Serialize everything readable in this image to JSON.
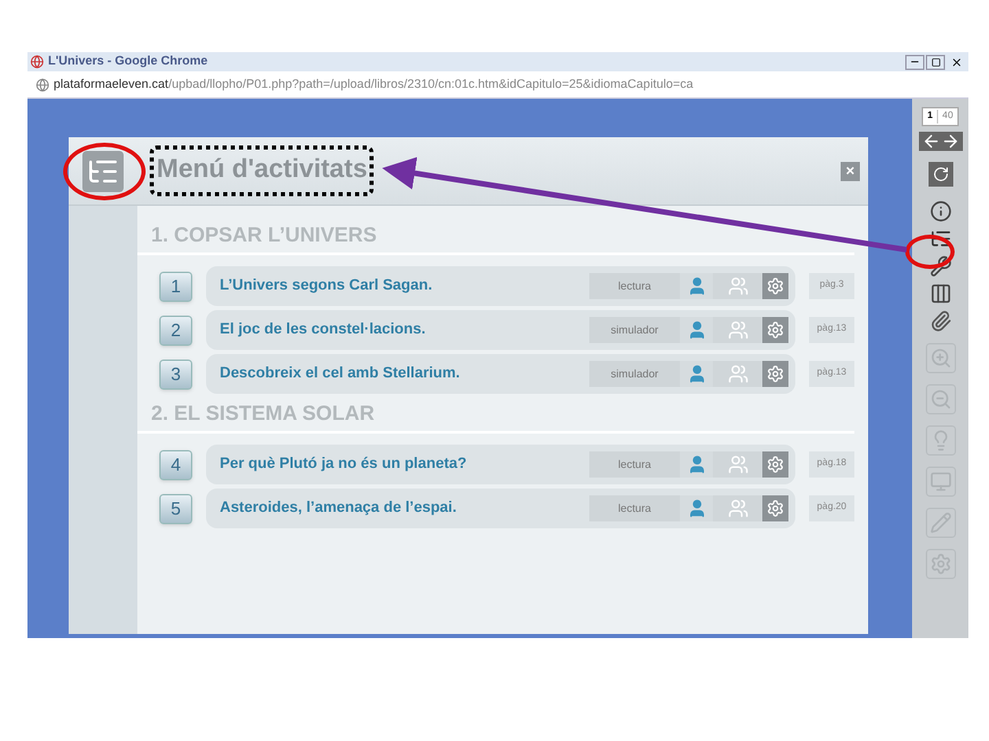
{
  "window": {
    "title": "L'Univers - Google Chrome"
  },
  "address_bar": {
    "host": "plataformaeleven.cat",
    "path": "/upbad/llopho/P01.php?path=/upload/libros/2310/cn:01c.htm&idCapitulo=25&idiomaCapitulo=ca"
  },
  "pager": {
    "current": "1",
    "total": "40"
  },
  "modal": {
    "title": "Menú d'activitats",
    "close": "×"
  },
  "sections": [
    {
      "title": "1. COPSAR L’UNIVERS",
      "activities": [
        {
          "number": "1",
          "title": "L’Univers segons Carl Sagan.",
          "type": "lectura",
          "page": "pàg.3"
        },
        {
          "number": "2",
          "title": "El joc de les constel·lacions.",
          "type": "simulador",
          "page": "pàg.13"
        },
        {
          "number": "3",
          "title": "Descobreix el cel amb Stellarium.",
          "type": "simulador",
          "page": "pàg.13"
        }
      ]
    },
    {
      "title": "2. EL SISTEMA SOLAR",
      "activities": [
        {
          "number": "4",
          "title": "Per què Plutó ja no és un planeta?",
          "type": "lectura",
          "page": "pàg.18"
        },
        {
          "number": "5",
          "title": "Asteroides, l’amenaça de l’espai.",
          "type": "lectura",
          "page": "pàg.20"
        }
      ]
    }
  ]
}
